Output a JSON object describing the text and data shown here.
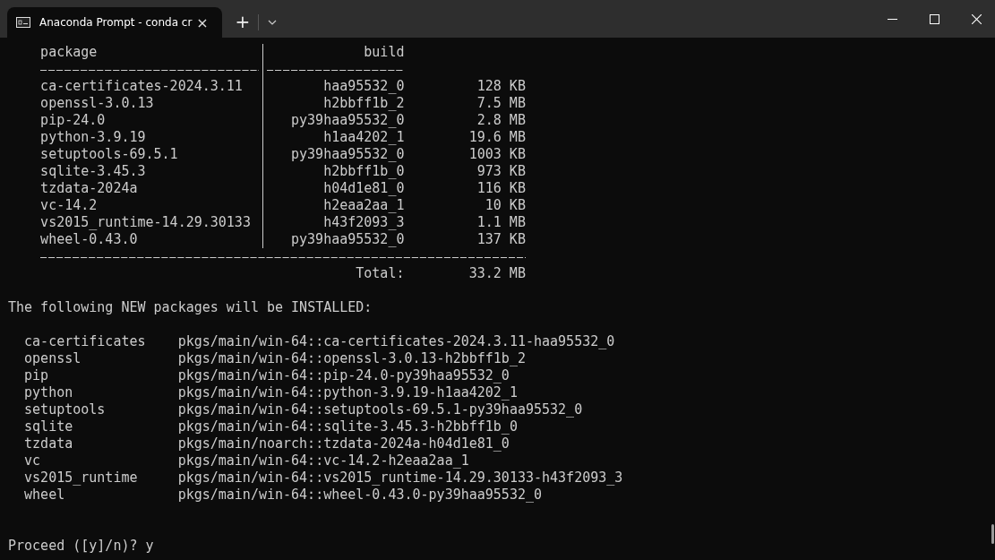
{
  "tab": {
    "title": "Anaconda Prompt - conda  cr",
    "selected": true,
    "close": "×"
  },
  "title_bar": {
    "new_tab": "+"
  },
  "package_table": {
    "header": {
      "package": "package",
      "build": "build"
    },
    "rows": [
      {
        "package": "ca-certificates-2024.3.11",
        "build": "haa95532_0",
        "size": "128 KB"
      },
      {
        "package": "openssl-3.0.13",
        "build": "h2bbff1b_2",
        "size": "7.5 MB"
      },
      {
        "package": "pip-24.0",
        "build": "py39haa95532_0",
        "size": "2.8 MB"
      },
      {
        "package": "python-3.9.19",
        "build": "h1aa4202_1",
        "size": "19.6 MB"
      },
      {
        "package": "setuptools-69.5.1",
        "build": "py39haa95532_0",
        "size": "1003 KB"
      },
      {
        "package": "sqlite-3.45.3",
        "build": "h2bbff1b_0",
        "size": "973 KB"
      },
      {
        "package": "tzdata-2024a",
        "build": "h04d1e81_0",
        "size": "116 KB"
      },
      {
        "package": "vc-14.2",
        "build": "h2eaa2aa_1",
        "size": "10 KB"
      },
      {
        "package": "vs2015_runtime-14.29.30133",
        "build": "h43f2093_3",
        "size": "1.1 MB"
      },
      {
        "package": "wheel-0.43.0",
        "build": "py39haa95532_0",
        "size": "137 KB"
      }
    ],
    "total": {
      "label": "Total:",
      "value": "33.2 MB"
    }
  },
  "install_message": "The following NEW packages will be INSTALLED:",
  "install_list": [
    {
      "name": "ca-certificates",
      "spec": "pkgs/main/win-64::ca-certificates-2024.3.11-haa95532_0"
    },
    {
      "name": "openssl",
      "spec": "pkgs/main/win-64::openssl-3.0.13-h2bbff1b_2"
    },
    {
      "name": "pip",
      "spec": "pkgs/main/win-64::pip-24.0-py39haa95532_0"
    },
    {
      "name": "python",
      "spec": "pkgs/main/win-64::python-3.9.19-h1aa4202_1"
    },
    {
      "name": "setuptools",
      "spec": "pkgs/main/win-64::setuptools-69.5.1-py39haa95532_0"
    },
    {
      "name": "sqlite",
      "spec": "pkgs/main/win-64::sqlite-3.45.3-h2bbff1b_0"
    },
    {
      "name": "tzdata",
      "spec": "pkgs/main/noarch::tzdata-2024a-h04d1e81_0"
    },
    {
      "name": "vc",
      "spec": "pkgs/main/win-64::vc-14.2-h2eaa2aa_1"
    },
    {
      "name": "vs2015_runtime",
      "spec": "pkgs/main/win-64::vs2015_runtime-14.29.30133-h43f2093_3"
    },
    {
      "name": "wheel",
      "spec": "pkgs/main/win-64::wheel-0.43.0-py39haa95532_0"
    }
  ],
  "prompt": {
    "question": "Proceed ([y]/n)?",
    "answer": "y"
  }
}
